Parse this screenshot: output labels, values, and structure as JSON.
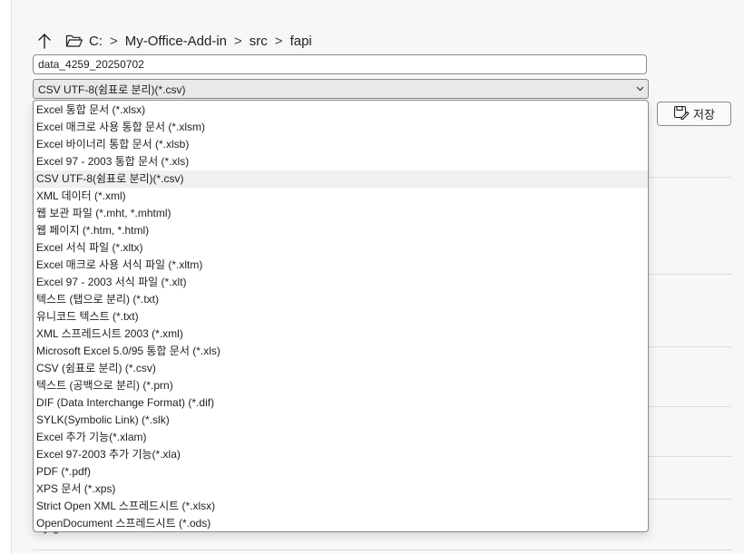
{
  "breadcrumb": {
    "segments": [
      "C:",
      "My-Office-Add-in",
      "src",
      "fapi"
    ],
    "separator": ">"
  },
  "file_name": {
    "value": "data_4259_20250702"
  },
  "file_type": {
    "selected": "CSV UTF-8(쉼표로 분리)(*.csv)",
    "selected_index": 4,
    "options": [
      "Excel 통합 문서 (*.xlsx)",
      "Excel 매크로 사용 통합 문서 (*.xlsm)",
      "Excel 바이너리 통합 문서 (*.xlsb)",
      "Excel 97 - 2003 통합 문서 (*.xls)",
      "CSV UTF-8(쉼표로 분리)(*.csv)",
      "XML 데이터 (*.xml)",
      "웹 보관 파일 (*.mht, *.mhtml)",
      "웹 페이지 (*.htm, *.html)",
      "Excel 서식 파일 (*.xltx)",
      "Excel 매크로 사용 서식 파일 (*.xltm)",
      "Excel 97 - 2003 서식 파일 (*.xlt)",
      "텍스트 (탭으로 분리) (*.txt)",
      "유니코드 텍스트 (*.txt)",
      "XML 스프레드시트 2003 (*.xml)",
      "Microsoft Excel 5.0/95 통합 문서 (*.xls)",
      "CSV (쉼표로 분리) (*.csv)",
      "텍스트 (공백으로 분리) (*.prn)",
      "DIF (Data Interchange Format) (*.dif)",
      "SYLK(Symbolic Link) (*.slk)",
      "Excel 추가 기능(*.xlam)",
      "Excel 97-2003 추가 기능(*.xla)",
      "PDF (*.pdf)",
      "XPS 문서 (*.xps)",
      "Strict Open XML 스프레드시트 (*.xlsx)",
      "OpenDocument 스프레드시트 (*.ods)"
    ]
  },
  "save_button": {
    "label": "저장",
    "icon": "save-icon"
  },
  "background": {
    "partial_text": "y g"
  },
  "colors": {
    "select_bg": "#e9e9e9",
    "selected_option_bg": "#f0f0f0",
    "border": "#8a8a8a"
  }
}
